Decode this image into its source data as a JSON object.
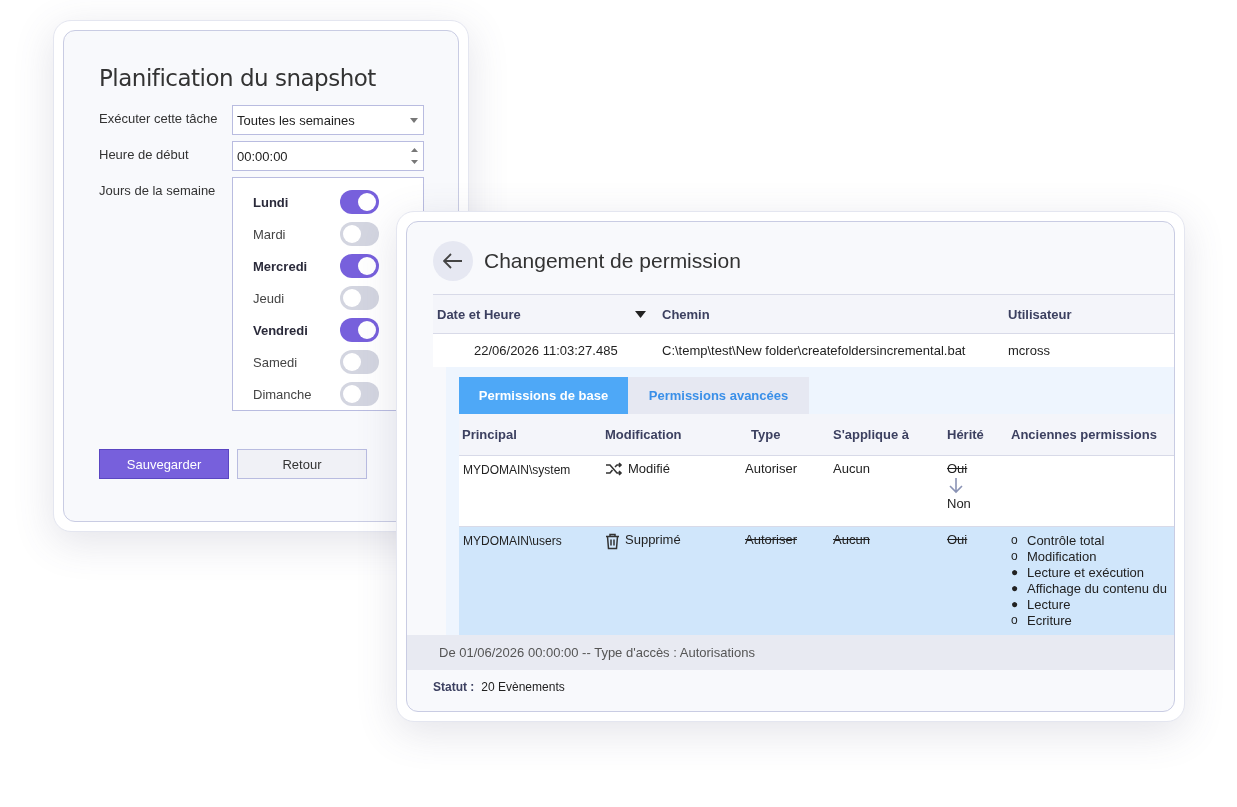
{
  "schedule": {
    "title": "Planification du snapshot",
    "fields": [
      {
        "label": "Exécuter cette tâche",
        "kind": "select",
        "value": "Toutes les semaines"
      },
      {
        "label": "Heure de début",
        "kind": "spinner",
        "value": "00:00:00"
      }
    ],
    "days_label": "Jours de la semaine",
    "days": [
      {
        "name": "Lundi",
        "on": true
      },
      {
        "name": "Mardi",
        "on": false
      },
      {
        "name": "Mercredi",
        "on": true
      },
      {
        "name": "Jeudi",
        "on": false
      },
      {
        "name": "Vendredi",
        "on": true
      },
      {
        "name": "Samedi",
        "on": false
      },
      {
        "name": "Dimanche",
        "on": false
      }
    ],
    "buttons": [
      {
        "label": "Sauvegarder",
        "kind": "primary"
      },
      {
        "label": "Retour",
        "kind": "secondary"
      }
    ]
  },
  "permission": {
    "title": "Changement de permission",
    "table": {
      "columns": [
        {
          "label": "Date et Heure",
          "sorted": true
        },
        {
          "label": "Chemin",
          "sorted": false
        },
        {
          "label": "Utilisateur",
          "sorted": false
        }
      ],
      "rows": [
        {
          "cells": [
            "22/06/2026 11:03:27.485",
            "C:\\temp\\test\\New folder\\createfoldersincremental.bat",
            "mcross"
          ],
          "expanded": true
        }
      ]
    },
    "tabs": [
      {
        "label": "Permissions de base",
        "selected": true
      },
      {
        "label": "Permissions avancées",
        "selected": false
      }
    ],
    "sub_table": {
      "columns": [
        "Principal",
        "Modification",
        "Type",
        "S'applique à",
        "Hérité",
        "Anciennes permissions"
      ],
      "rows": [
        {
          "principal": "MYDOMAIN\\system",
          "change": {
            "kind": "modified",
            "label": "Modifié"
          },
          "type": {
            "text": "Autoriser",
            "struck": false
          },
          "applies": {
            "text": "Aucun",
            "struck": false
          },
          "inherited": {
            "old": "Oui",
            "new": "Non"
          },
          "old_permissions": [],
          "selected": false
        },
        {
          "principal": "MYDOMAIN\\users",
          "change": {
            "kind": "deleted",
            "label": "Supprimé"
          },
          "type": {
            "text": "Autoriser",
            "struck": true
          },
          "applies": {
            "text": "Aucun",
            "struck": true
          },
          "inherited": {
            "old": "Oui"
          },
          "old_permissions": [
            {
              "marker": "o",
              "text": "Contrôle total"
            },
            {
              "marker": "o",
              "text": "Modification"
            },
            {
              "marker": "●",
              "text": "Lecture et exécution"
            },
            {
              "marker": "●",
              "text": "Affichage du contenu du"
            },
            {
              "marker": "●",
              "text": "Lecture"
            },
            {
              "marker": "o",
              "text": "Ecriture"
            }
          ],
          "selected": true
        }
      ]
    },
    "filter_bar": "De 01/06/2026 00:00:00 -- Type d'accès : Autorisations",
    "status": {
      "label": "Statut :",
      "value": "20 Evènements"
    }
  }
}
